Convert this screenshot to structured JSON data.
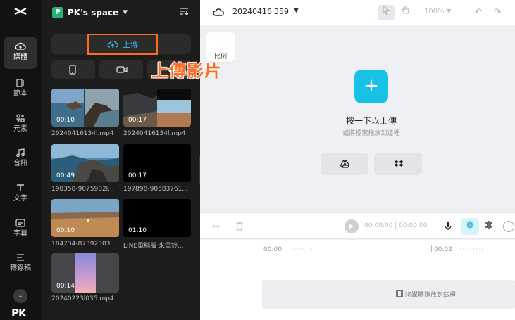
{
  "rail": {
    "items": [
      {
        "label": "媒體",
        "icon": "cloud-upload-icon",
        "active": true
      },
      {
        "label": "範本",
        "icon": "template-icon"
      },
      {
        "label": "元素",
        "icon": "elements-icon"
      },
      {
        "label": "音訊",
        "icon": "music-note-icon"
      },
      {
        "label": "文字",
        "icon": "text-icon"
      },
      {
        "label": "字幕",
        "icon": "subtitle-icon"
      },
      {
        "label": "轉錄稿",
        "icon": "transcript-icon"
      }
    ],
    "brand": "PK"
  },
  "panel": {
    "space_badge": "P",
    "space_name": "PK's space",
    "upload_label": "上傳",
    "callout": "上傳影片",
    "media": [
      {
        "duration": "00:10",
        "name": "20240416134l.mp4"
      },
      {
        "duration": "00:17",
        "name": "20240416134l.mp4"
      },
      {
        "duration": "00:49",
        "name": "198358-9075982l..."
      },
      {
        "duration": "00:17",
        "name": "197898-905837613..."
      },
      {
        "duration": "00:10",
        "name": "184734-87392303..."
      },
      {
        "duration": "01:10",
        "name": "LINE電腦版 來電鈴..."
      },
      {
        "duration": "00:14",
        "name": "20240223l035.mp4"
      }
    ]
  },
  "workspace": {
    "project_name": "20240416l359",
    "zoom": "100%",
    "ratio_label": "比例",
    "drop_title": "按一下以上傳",
    "drop_subtitle": "或將檔案拖放到這裡",
    "timecode_current": "00:00:00",
    "timecode_total": "00:00:00",
    "ruler_labels": [
      "00:00",
      "00:02"
    ],
    "track_hint": "將媒體拖放到這裡"
  },
  "colors": {
    "accent": "#18c1e6",
    "callout": "#ff6a1f",
    "badge": "#22b573"
  }
}
